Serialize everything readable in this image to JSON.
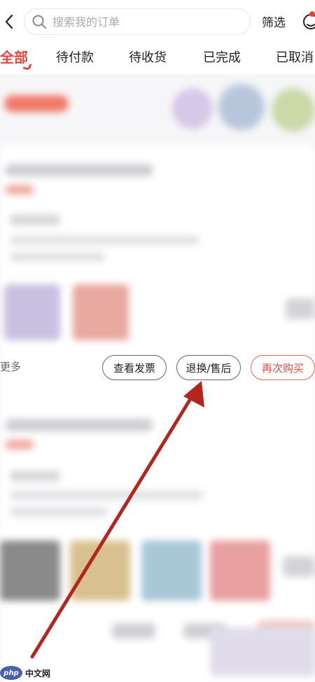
{
  "header": {
    "search_placeholder": "搜索我的订单",
    "filter_label": "筛选"
  },
  "tabs": [
    {
      "label": "全部",
      "active": true
    },
    {
      "label": "待付款",
      "active": false
    },
    {
      "label": "待收货",
      "active": false
    },
    {
      "label": "已完成",
      "active": false
    },
    {
      "label": "已取消",
      "active": false
    }
  ],
  "order_actions": {
    "more_label": "更多",
    "invoice_button": "查看发票",
    "return_button": "退换/售后",
    "rebuy_button": "再次购买"
  },
  "watermark": {
    "logo_text": "php",
    "site_text": "中文网"
  },
  "colors": {
    "accent": "#e8453c",
    "annotation_arrow": "#b3261e"
  }
}
